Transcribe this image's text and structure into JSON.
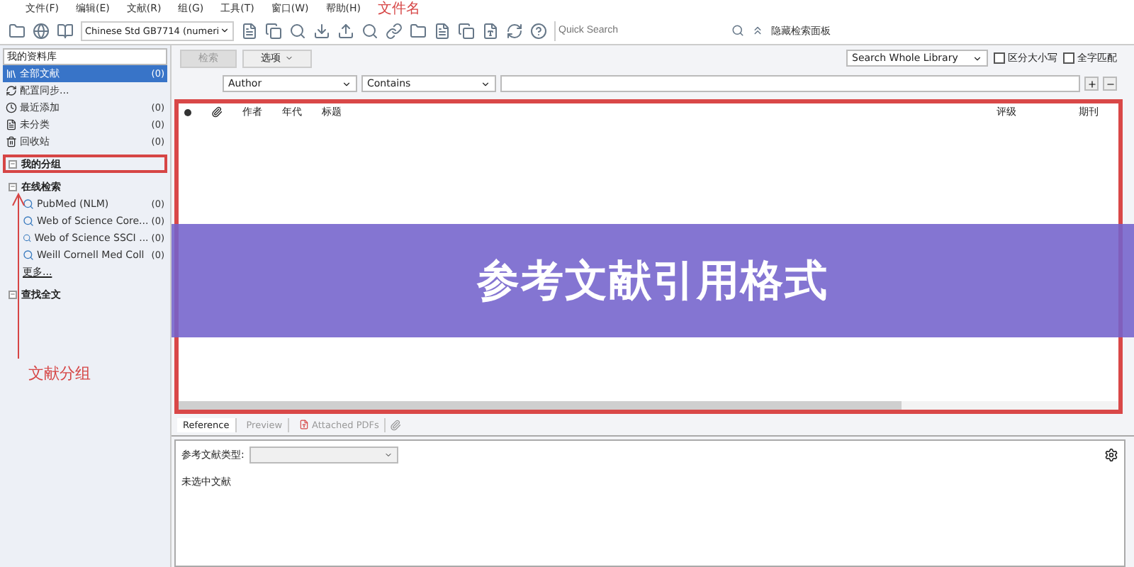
{
  "menu": [
    "文件(F)",
    "编辑(E)",
    "文献(R)",
    "组(G)",
    "工具(T)",
    "窗口(W)",
    "帮助(H)"
  ],
  "menu_annotation": "文件名",
  "toolbar": {
    "style": "Chinese Std GB7714 (numeri",
    "quick_search_placeholder": "Quick Search",
    "hide_panel": "隐藏检索面板"
  },
  "sidebar": {
    "library": "我的资料库",
    "items": [
      {
        "label": "全部文献",
        "count": "(0)",
        "selected": true
      },
      {
        "label": "配置同步...",
        "selected": false
      },
      {
        "label": "最近添加",
        "count": "(0)",
        "selected": false
      },
      {
        "label": "未分类",
        "count": "(0)",
        "selected": false
      },
      {
        "label": "回收站",
        "count": "(0)",
        "selected": false
      }
    ],
    "groups": [
      {
        "label": "我的分组",
        "expanded": true,
        "highlighted": true
      },
      {
        "label": "在线检索",
        "expanded": true,
        "highlighted": false,
        "children": [
          {
            "label": "PubMed (NLM)",
            "count": "(0)"
          },
          {
            "label": "Web of Science Core...",
            "count": "(0)"
          },
          {
            "label": "Web of Science SSCI ...",
            "count": "(0)"
          },
          {
            "label": "Weill Cornell Med Coll",
            "count": "(0)"
          }
        ],
        "more": "更多..."
      },
      {
        "label": "查找全文",
        "expanded": true,
        "highlighted": false
      }
    ],
    "annotation": "文献分组"
  },
  "search": {
    "search_button": "检索",
    "options_button": "选项",
    "scope": "Search Whole Library",
    "match_case": {
      "label": "区分大小写",
      "checked": false
    },
    "match_words": {
      "label": "全字匹配",
      "checked": false
    },
    "field": "Author",
    "operator": "Contains"
  },
  "table": {
    "columns": [
      "作者",
      "年代",
      "标题",
      "评级",
      "期刊"
    ]
  },
  "tabs": [
    {
      "label": "Reference",
      "selected": true
    },
    {
      "label": "Preview",
      "selected": false
    },
    {
      "label": "Attached PDFs",
      "selected": false
    }
  ],
  "reference": {
    "type_label": "参考文献类型:",
    "empty": "未选中文献"
  },
  "banner": "参考文献引用格式"
}
